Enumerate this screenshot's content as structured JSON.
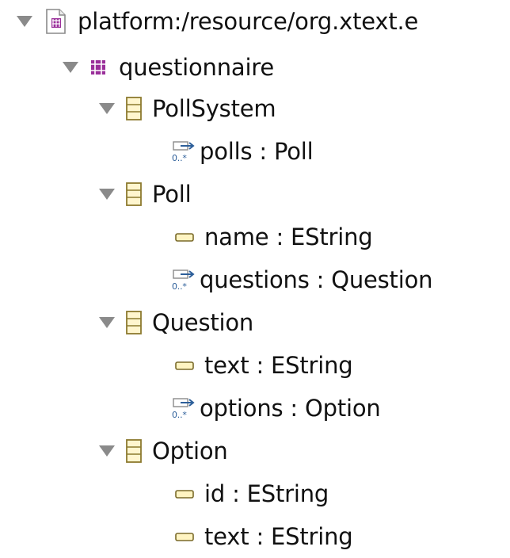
{
  "tree": {
    "resource": {
      "label": "platform:/resource/org.xtext.e",
      "icon": "ecore-resource-file-icon",
      "expanded": true
    },
    "package": {
      "label": "questionnaire",
      "icon": "epackage-icon",
      "expanded": true
    },
    "classes": [
      {
        "label": "PollSystem",
        "icon": "eclass-icon",
        "expanded": true,
        "features": [
          {
            "label": "polls : Poll",
            "icon": "ereference-multi-icon"
          }
        ]
      },
      {
        "label": "Poll",
        "icon": "eclass-icon",
        "expanded": true,
        "features": [
          {
            "label": "name : EString",
            "icon": "eattribute-icon"
          },
          {
            "label": "questions : Question",
            "icon": "ereference-multi-icon"
          }
        ]
      },
      {
        "label": "Question",
        "icon": "eclass-icon",
        "expanded": true,
        "features": [
          {
            "label": "text : EString",
            "icon": "eattribute-icon"
          },
          {
            "label": "options : Option",
            "icon": "ereference-multi-icon"
          }
        ]
      },
      {
        "label": "Option",
        "icon": "eclass-icon",
        "expanded": true,
        "features": [
          {
            "label": "id : EString",
            "icon": "eattribute-icon"
          },
          {
            "label": "text : EString",
            "icon": "eattribute-icon"
          }
        ]
      }
    ],
    "colors": {
      "package_purple": "#9a2f9a",
      "class_fill": "#fff6cf",
      "class_stroke": "#8c7a2f",
      "attribute_fill": "#fff4c2",
      "reference_blue": "#2d5f9a",
      "twisty_gray": "#8a8a8a"
    }
  }
}
